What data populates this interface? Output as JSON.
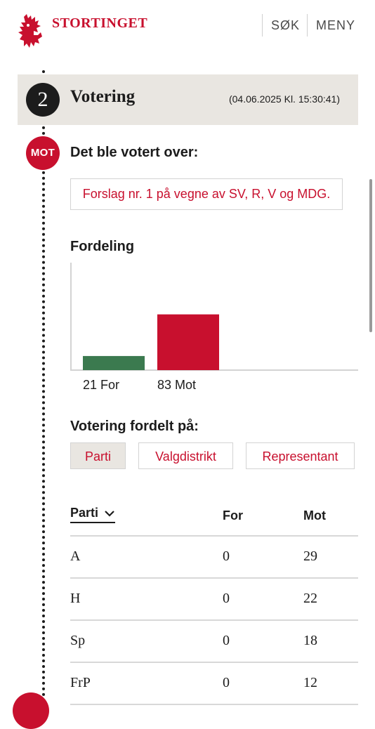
{
  "header": {
    "logo_text": "STORTINGET",
    "search_label": "SØK",
    "menu_label": "MENY"
  },
  "vote": {
    "number": "2",
    "title": "Votering",
    "datetime": "(04.06.2025 Kl. 15:30:41)",
    "result_badge": "MOT",
    "voted_over_heading": "Det ble votert over:",
    "proposal": "Forslag nr. 1 på vegne av SV, R, V og MDG."
  },
  "distribution": {
    "heading": "Fordeling"
  },
  "chart_data": {
    "type": "bar",
    "categories": [
      "For",
      "Mot"
    ],
    "values": [
      21,
      83
    ],
    "labels": [
      "21 For",
      "83 Mot"
    ],
    "colors": [
      "#3b7a4f",
      "#c8102e"
    ],
    "ylim": [
      0,
      160
    ],
    "grid": false
  },
  "breakdown": {
    "heading": "Votering fordelt på:",
    "tabs": [
      {
        "label": "Parti",
        "active": true
      },
      {
        "label": "Valgdistrikt",
        "active": false
      },
      {
        "label": "Representant",
        "active": false
      }
    ]
  },
  "table": {
    "headers": {
      "parti": "Parti",
      "for": "For",
      "mot": "Mot"
    },
    "rows": [
      {
        "parti": "A",
        "for": "0",
        "mot": "29"
      },
      {
        "parti": "H",
        "for": "0",
        "mot": "22"
      },
      {
        "parti": "Sp",
        "for": "0",
        "mot": "18"
      },
      {
        "parti": "FrP",
        "for": "0",
        "mot": "12"
      }
    ]
  },
  "colors": {
    "brand_red": "#c8102e",
    "for_green": "#3b7a4f",
    "band_bg": "#e9e6e1"
  }
}
